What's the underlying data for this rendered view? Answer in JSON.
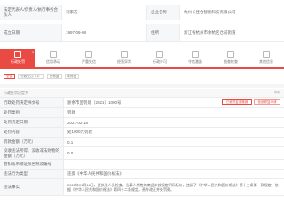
{
  "info": {
    "row1": {
      "label1": "法定代表人/负责人/执行事务合伙人",
      "value1": "刘家志",
      "label2": "企业名称",
      "value2": "杭州长佳合智能科技有限公司"
    },
    "row2": {
      "label1": "成立日期",
      "value1": "1997-06-08",
      "label2": "住所",
      "value2": "浙江省杭州市余杭区仓前街道"
    }
  },
  "tabs": [
    {
      "label": "行政处罚",
      "count": "1"
    },
    {
      "label": "信用承诺",
      "count": ""
    },
    {
      "label": "严重失信",
      "count": ""
    },
    {
      "label": "经营异常",
      "count": ""
    },
    {
      "label": "行政许可",
      "count": ""
    },
    {
      "label": "守信激励",
      "count": ""
    },
    {
      "label": "抽查检查",
      "count": ""
    },
    {
      "label": "其他信息",
      "count": ""
    }
  ],
  "filters": [
    "全部",
    "行政处罚（1）",
    "已修复",
    "未修复"
  ],
  "detail": {
    "header": "行政处罚决定书",
    "help": "帮助",
    "rows": [
      {
        "label": "行政处罚决定书文号",
        "value": "浙余市监罚处〔2021〕1000号",
        "actions": [
          "已被修复或撤销",
          "信用修复申请"
        ]
      },
      {
        "label": "处罚类别",
        "value": "罚款"
      },
      {
        "label": "处罚决定日期",
        "value": "2021-02-18"
      },
      {
        "label": "处罚内容",
        "value": "处1000元罚款"
      },
      {
        "label": "罚款金额（万元）",
        "value": "0.1"
      },
      {
        "label": "没收违法所得、没收非法财物的金额（万元）",
        "value": "0.0"
      },
      {
        "label": "暂扣或吊销证照名称及编号",
        "value": ""
      },
      {
        "label": "违法行为类型",
        "value": "违反《中华人民共和国价格法》"
      },
      {
        "label": "违法事实",
        "value": "2021年01月18日，经执法人员检查，当事人销售的商品未按规定明码标价，违反了《中华人民共和国价格法》第十三条第一款规定，依据《中华人民共和国价格法》第四十二条规定，责令改正并处罚款。"
      }
    ]
  }
}
